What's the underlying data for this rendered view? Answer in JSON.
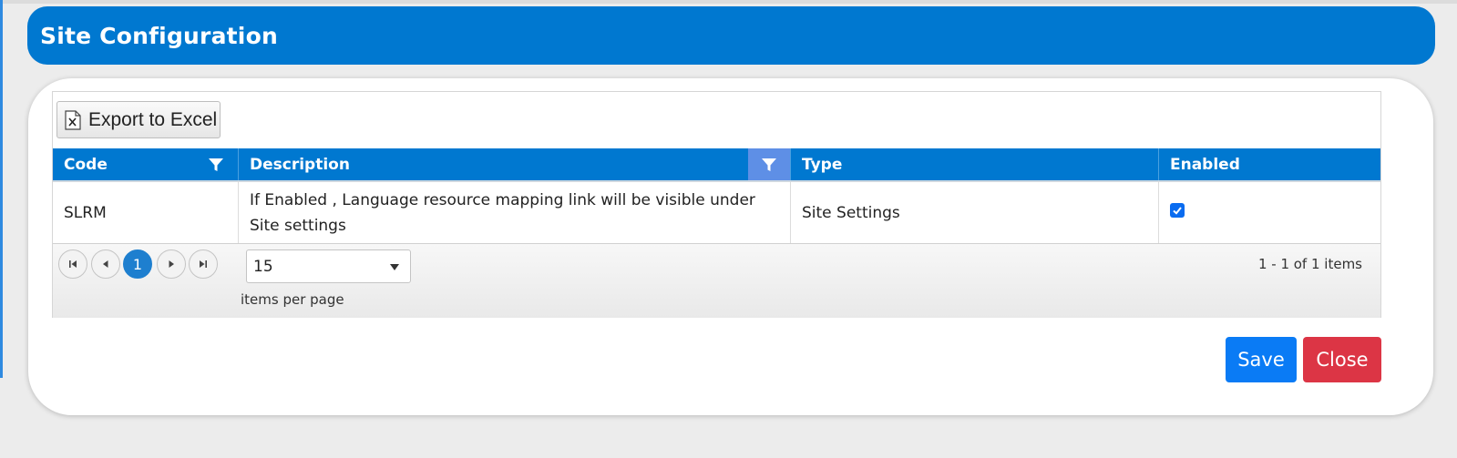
{
  "header": {
    "title": "Site Configuration"
  },
  "toolbar": {
    "export_label": "Export to Excel",
    "export_icon": "excel-icon"
  },
  "grid": {
    "columns": [
      "Code",
      "Description",
      "Type",
      "Enabled"
    ],
    "rows": [
      {
        "code": "SLRM",
        "description": "If Enabled , Language resource mapping link will be visible under Site settings",
        "type": "Site Settings",
        "enabled": true
      }
    ]
  },
  "pager": {
    "current_page": "1",
    "page_size": "15",
    "items_per_page_label": "items per page",
    "info": "1 - 1 of 1 items"
  },
  "actions": {
    "save_label": "Save",
    "close_label": "Close"
  },
  "colors": {
    "header": "#0078d0",
    "save": "#0a7bf5",
    "close": "#dc3545",
    "filter_active": "#5e8fe6"
  }
}
